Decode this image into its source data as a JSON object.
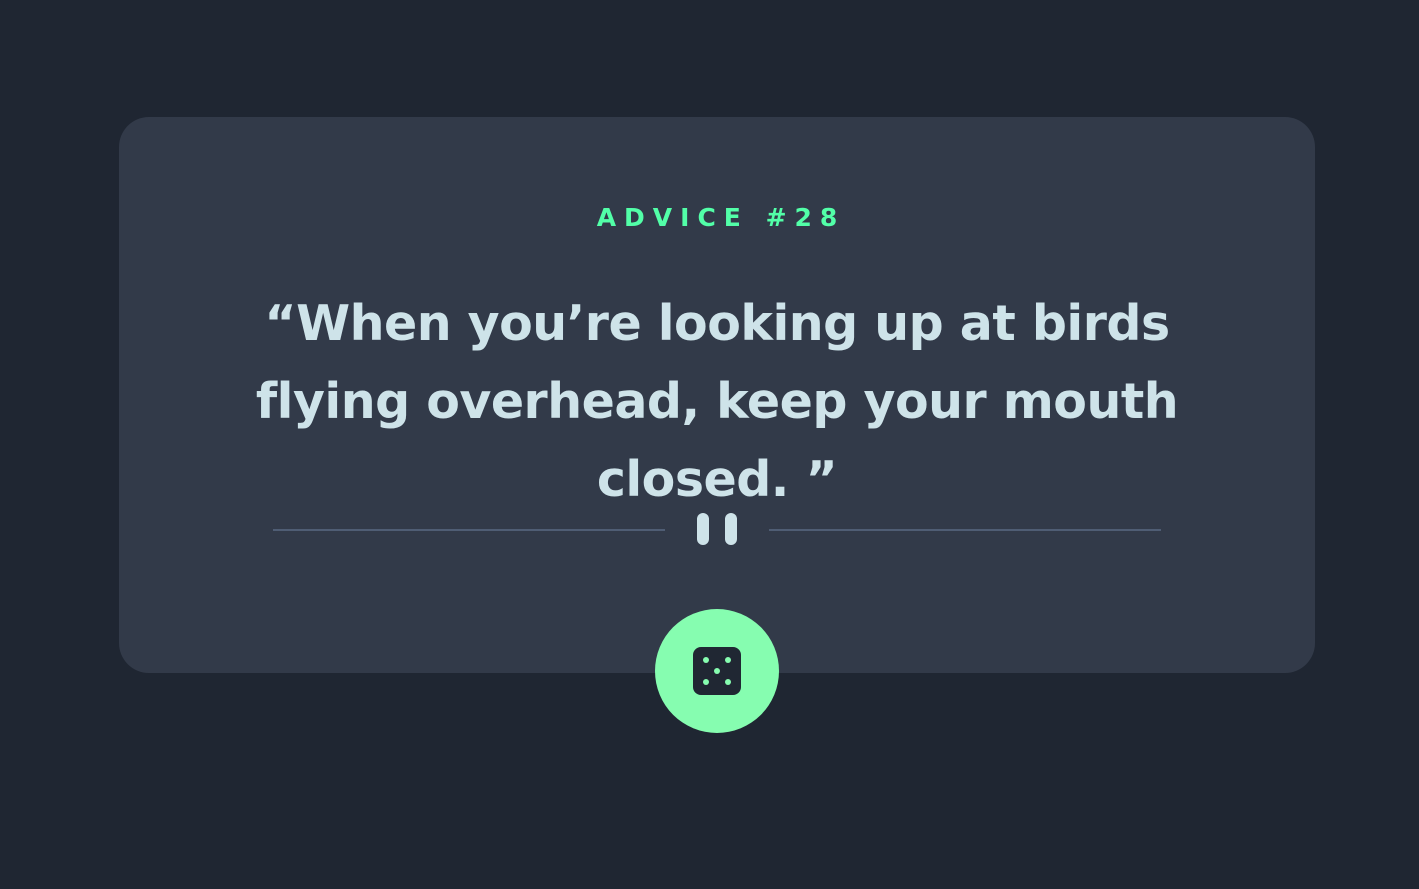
{
  "advice": {
    "id_label": "ADVICE #28",
    "quote": "“When you’re looking up at birds flying overhead, keep your mouth closed. ”"
  },
  "icons": {
    "divider": "pause-icon",
    "button": "dice-icon"
  },
  "colors": {
    "background": "#1f2632",
    "card": "#323a49",
    "accent": "#52ffa8",
    "text": "#cee3e9",
    "divider": "#4f5d74"
  }
}
